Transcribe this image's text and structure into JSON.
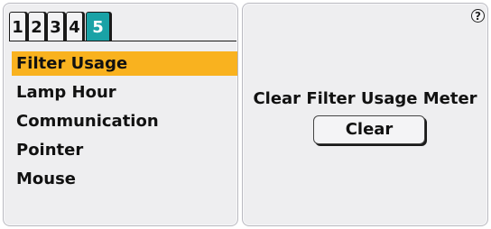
{
  "tabs": [
    {
      "label": "1"
    },
    {
      "label": "2"
    },
    {
      "label": "3"
    },
    {
      "label": "4"
    },
    {
      "label": "5",
      "active": true
    }
  ],
  "menu": {
    "items": [
      {
        "label": "Filter Usage",
        "selected": true
      },
      {
        "label": "Lamp Hour"
      },
      {
        "label": "Communication"
      },
      {
        "label": "Pointer"
      },
      {
        "label": "Mouse"
      }
    ]
  },
  "detail": {
    "title": "Clear Filter Usage Meter",
    "button_label": "Clear",
    "help_glyph": "?"
  },
  "colors": {
    "active_tab": "#1aa2a6",
    "selected_item": "#f9b21f",
    "panel_bg": "#eeeef0"
  }
}
